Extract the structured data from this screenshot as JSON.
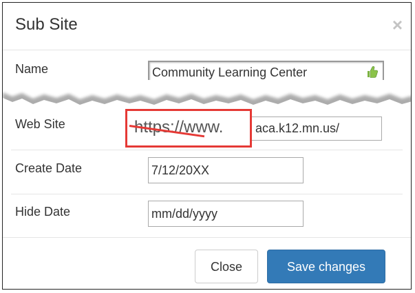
{
  "dialog": {
    "title": "Sub Site",
    "close_icon": "×"
  },
  "fields": {
    "name": {
      "label": "Name",
      "value": "Community Learning Center"
    },
    "web_site": {
      "label": "Web Site",
      "value": "aca.k12.mn.us/",
      "annotation": "https://www."
    },
    "create_date": {
      "label": "Create Date",
      "value": "7/12/20XX"
    },
    "hide_date": {
      "label": "Hide Date",
      "placeholder": "mm/dd/yyyy"
    }
  },
  "footer": {
    "close_label": "Close",
    "save_label": "Save changes"
  },
  "colors": {
    "primary": "#337ab7",
    "annotation_red": "#e53935",
    "thumb_green": "#7cb342"
  },
  "icons": {
    "name_field": "thumbs-up-icon",
    "dismiss": "close-icon"
  }
}
